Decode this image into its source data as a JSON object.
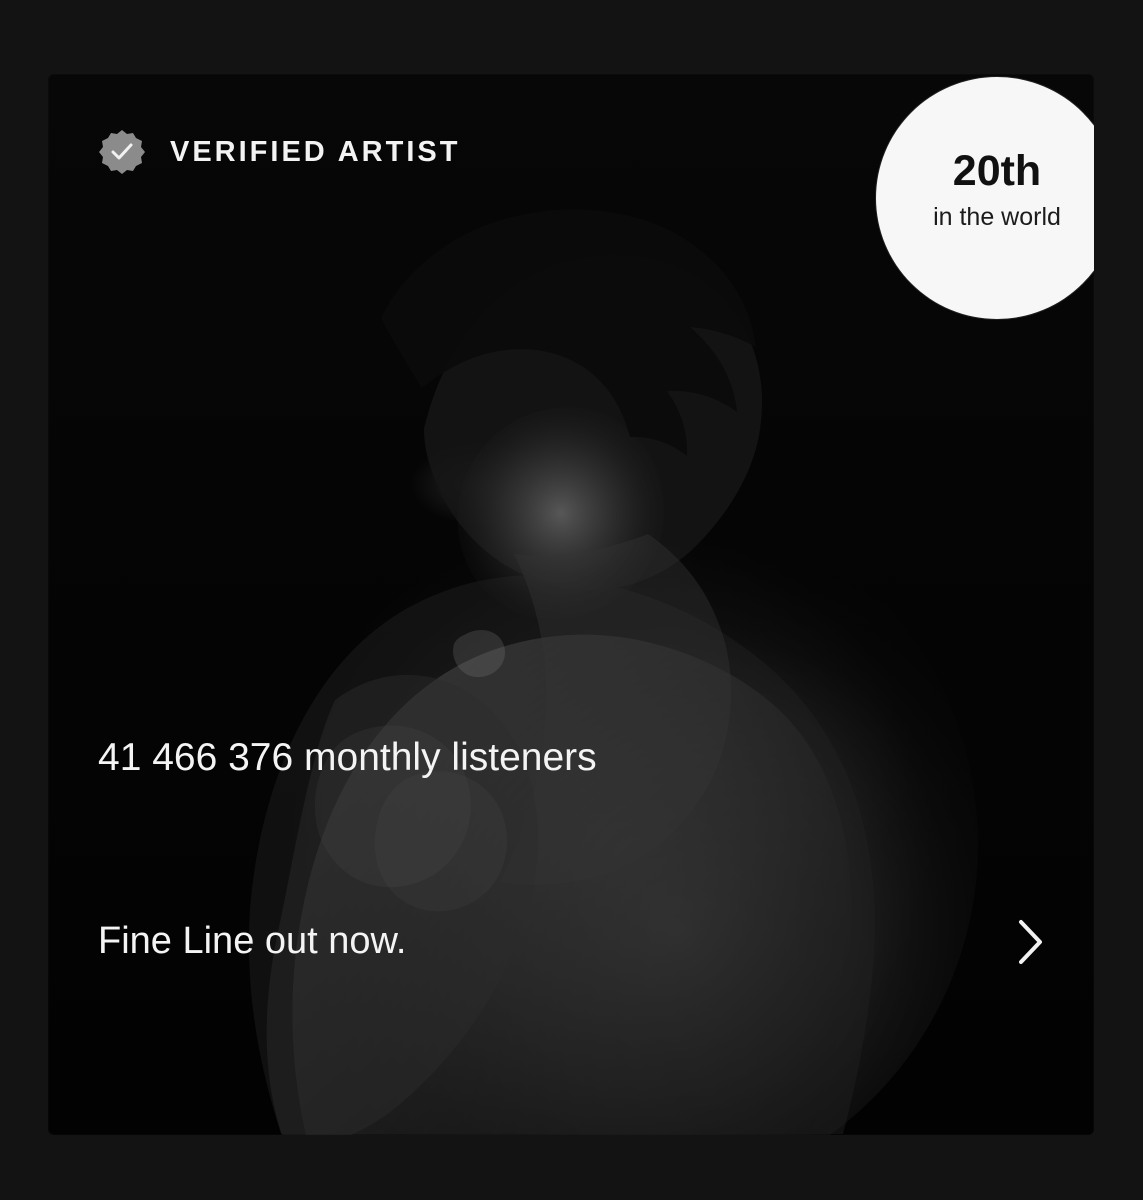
{
  "artist_card": {
    "verified_label": "VERIFIED ARTIST",
    "rank": {
      "value": "20th",
      "label": "in the world"
    },
    "monthly_listeners_text": "41 466 376 monthly listeners",
    "release_text": "Fine Line out now."
  },
  "icons": {
    "verified": "verified-badge-icon",
    "next": "chevron-right-icon"
  },
  "colors": {
    "page_background": "#131313",
    "card_background": "#050505",
    "badge_background": "#f7f7f7",
    "primary_text": "#f4f4f4",
    "badge_text": "#111111",
    "verified_icon": "#8b8b8b"
  }
}
